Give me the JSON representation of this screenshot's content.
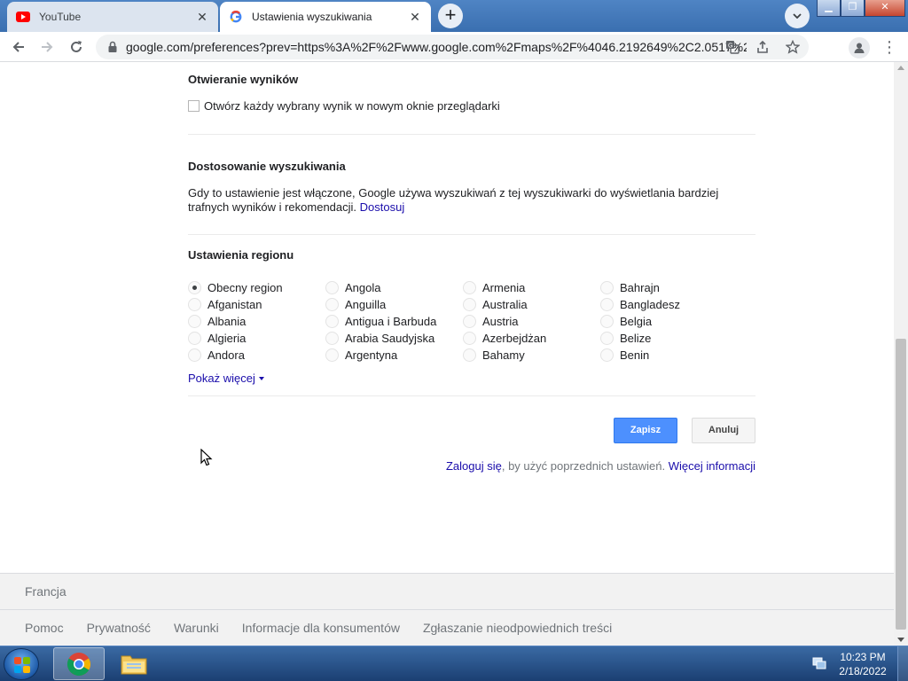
{
  "browser": {
    "tabs": [
      {
        "title": "YouTube",
        "active": false,
        "icon": "youtube-icon"
      },
      {
        "title": "Ustawienia wyszukiwania",
        "active": true,
        "icon": "google-icon"
      }
    ],
    "url": "google.com/preferences?prev=https%3A%2F%2Fwww.google.com%2Fmaps%2F%4046.2192649%2C2.0517%2C..."
  },
  "open_results": {
    "heading": "Otwieranie wyników",
    "checkbox_label": "Otwórz każdy wybrany wynik w nowym oknie przeglądarki",
    "checked": false
  },
  "personalization": {
    "heading": "Dostosowanie wyszukiwania",
    "text": "Gdy to ustawienie jest włączone, Google używa wyszukiwań z tej wyszukiwarki do wyświetlania bardziej trafnych wyników i rekomendacji.",
    "link": "Dostosuj"
  },
  "region": {
    "heading": "Ustawienia regionu",
    "selected": "Obecny region",
    "columns": [
      [
        "Obecny region",
        "Afganistan",
        "Albania",
        "Algieria",
        "Andora"
      ],
      [
        "Angola",
        "Anguilla",
        "Antigua i Barbuda",
        "Arabia Saudyjska",
        "Argentyna"
      ],
      [
        "Armenia",
        "Australia",
        "Austria",
        "Azerbejdżan",
        "Bahamy"
      ],
      [
        "Bahrajn",
        "Bangladesz",
        "Belgia",
        "Belize",
        "Benin"
      ]
    ],
    "show_more": "Pokaż więcej"
  },
  "actions": {
    "save": "Zapisz",
    "cancel": "Anuluj",
    "signin_link": "Zaloguj się",
    "signin_text": ", by użyć poprzednich ustawień.",
    "more_info": "Więcej informacji"
  },
  "footer": {
    "country": "Francja",
    "links": [
      "Pomoc",
      "Prywatność",
      "Warunki",
      "Informacje dla konsumentów",
      "Zgłaszanie nieodpowiednich treści"
    ]
  },
  "taskbar": {
    "time": "10:23 PM",
    "date": "2/18/2022"
  }
}
